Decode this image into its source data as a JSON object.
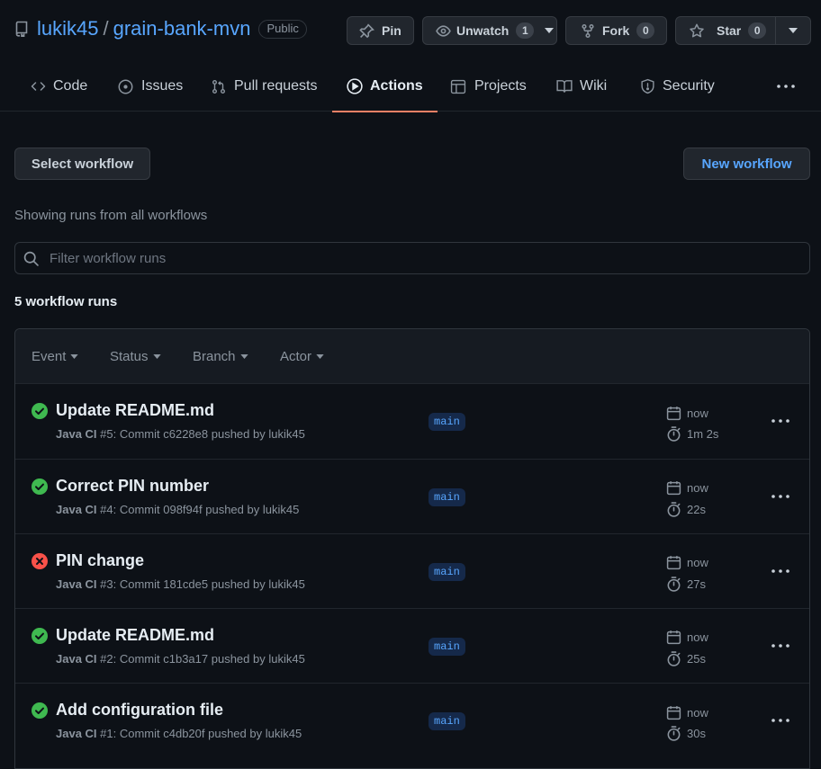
{
  "repo": {
    "owner": "lukik45",
    "separator": "/",
    "name": "grain-bank-mvn",
    "visibility": "Public"
  },
  "repo_actions": {
    "pin": "Pin",
    "unwatch": "Unwatch",
    "watch_count": "1",
    "fork": "Fork",
    "fork_count": "0",
    "star": "Star",
    "star_count": "0"
  },
  "tabs": [
    {
      "label": "Code",
      "icon": "code-icon"
    },
    {
      "label": "Issues",
      "icon": "issue-icon"
    },
    {
      "label": "Pull requests",
      "icon": "pull-request-icon"
    },
    {
      "label": "Actions",
      "icon": "play-icon",
      "selected": true
    },
    {
      "label": "Projects",
      "icon": "table-icon"
    },
    {
      "label": "Wiki",
      "icon": "book-icon"
    },
    {
      "label": "Security",
      "icon": "shield-icon"
    }
  ],
  "toolbar": {
    "select_workflow": "Select workflow",
    "new_workflow": "New workflow"
  },
  "showing_label": "Showing runs from all workflows",
  "filter": {
    "placeholder": "Filter workflow runs",
    "value": ""
  },
  "run_count_label": "5 workflow runs",
  "filters": [
    "Event",
    "Status",
    "Branch",
    "Actor"
  ],
  "runs": [
    {
      "status": "success",
      "title": "Update README.md",
      "workflow": "Java CI",
      "meta": "#5: Commit c6228e8 pushed by lukik45",
      "branch": "main",
      "when": "now",
      "duration": "1m 2s"
    },
    {
      "status": "success",
      "title": "Correct PIN number",
      "workflow": "Java CI",
      "meta": "#4: Commit 098f94f pushed by lukik45",
      "branch": "main",
      "when": "now",
      "duration": "22s"
    },
    {
      "status": "failure",
      "title": "PIN change",
      "workflow": "Java CI",
      "meta": "#3: Commit 181cde5 pushed by lukik45",
      "branch": "main",
      "when": "now",
      "duration": "27s"
    },
    {
      "status": "success",
      "title": "Update README.md",
      "workflow": "Java CI",
      "meta": "#2: Commit c1b3a17 pushed by lukik45",
      "branch": "main",
      "when": "now",
      "duration": "25s"
    },
    {
      "status": "success",
      "title": "Add configuration file",
      "workflow": "Java CI",
      "meta": "#1: Commit c4db20f pushed by lukik45",
      "branch": "main",
      "when": "now",
      "duration": "30s"
    }
  ],
  "colors": {
    "background": "#0d1117",
    "accent_link": "#58a6ff",
    "success": "#3fb950",
    "failure": "#f85149",
    "selected_tab_underline": "#f78166"
  }
}
